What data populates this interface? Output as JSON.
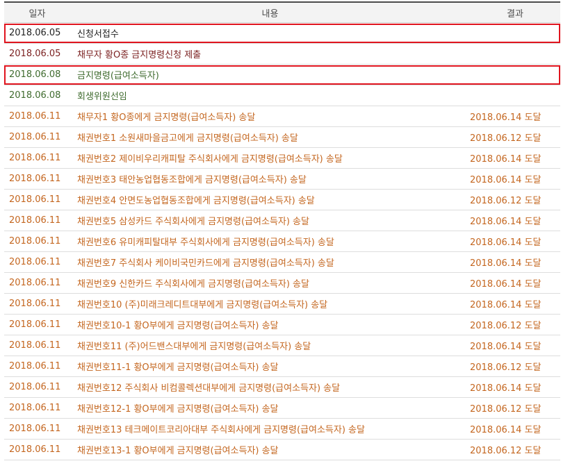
{
  "table": {
    "headers": {
      "date": "일자",
      "content": "내용",
      "result": "결과"
    },
    "rows": [
      {
        "date": "2018.06.05",
        "content": "신청서접수",
        "result": "",
        "tone": "black",
        "highlighted": true
      },
      {
        "date": "2018.06.05",
        "content": "채무자 황O종 금지명령신청 제출",
        "result": "",
        "tone": "darkred",
        "highlighted": false
      },
      {
        "date": "2018.06.08",
        "content": "금지명령(급여소득자)",
        "result": "",
        "tone": "green",
        "highlighted": true
      },
      {
        "date": "2018.06.08",
        "content": "회생위원선임",
        "result": "",
        "tone": "green",
        "highlighted": false
      },
      {
        "date": "2018.06.11",
        "content": "채무자1 황O종에게 금지명령(급여소득자) 송달",
        "result": "2018.06.14 도달",
        "tone": "orange",
        "highlighted": false
      },
      {
        "date": "2018.06.11",
        "content": "채권번호1 소원새마을금고에게 금지명령(급여소득자) 송달",
        "result": "2018.06.12 도달",
        "tone": "orange",
        "highlighted": false
      },
      {
        "date": "2018.06.11",
        "content": "채권번호2 제이비우리캐피탈 주식회사에게 금지명령(급여소득자) 송달",
        "result": "2018.06.14 도달",
        "tone": "orange",
        "highlighted": false
      },
      {
        "date": "2018.06.11",
        "content": "채권번호3 태안농업협동조합에게 금지명령(급여소득자) 송달",
        "result": "2018.06.14 도달",
        "tone": "orange",
        "highlighted": false
      },
      {
        "date": "2018.06.11",
        "content": "채권번호4 안면도농업협동조합에게 금지명령(급여소득자) 송달",
        "result": "2018.06.12 도달",
        "tone": "orange",
        "highlighted": false
      },
      {
        "date": "2018.06.11",
        "content": "채권번호5 삼성카드 주식회사에게 금지명령(급여소득자) 송달",
        "result": "2018.06.14 도달",
        "tone": "orange",
        "highlighted": false
      },
      {
        "date": "2018.06.11",
        "content": "채권번호6 유미캐피탈대부 주식회사에게 금지명령(급여소득자) 송달",
        "result": "2018.06.14 도달",
        "tone": "orange",
        "highlighted": false
      },
      {
        "date": "2018.06.11",
        "content": "채권번호7 주식회사 케이비국민카드에게 금지명령(급여소득자) 송달",
        "result": "2018.06.14 도달",
        "tone": "orange",
        "highlighted": false
      },
      {
        "date": "2018.06.11",
        "content": "채권번호9 신한카드 주식회사에게 금지명령(급여소득자) 송달",
        "result": "2018.06.14 도달",
        "tone": "orange",
        "highlighted": false
      },
      {
        "date": "2018.06.11",
        "content": "채권번호10 (주)미래크레디트대부에게 금지명령(급여소득자) 송달",
        "result": "2018.06.14 도달",
        "tone": "orange",
        "highlighted": false
      },
      {
        "date": "2018.06.11",
        "content": "채권번호10-1 황O부에게 금지명령(급여소득자) 송달",
        "result": "2018.06.12 도달",
        "tone": "orange",
        "highlighted": false
      },
      {
        "date": "2018.06.11",
        "content": "채권번호11 (주)어드밴스대부에게 금지명령(급여소득자) 송달",
        "result": "2018.06.14 도달",
        "tone": "orange",
        "highlighted": false
      },
      {
        "date": "2018.06.11",
        "content": "채권번호11-1 황O부에게 금지명령(급여소득자) 송달",
        "result": "2018.06.12 도달",
        "tone": "orange",
        "highlighted": false
      },
      {
        "date": "2018.06.11",
        "content": "채권번호12 주식회사 비컴콜렉션대부에게 금지명령(급여소득자) 송달",
        "result": "2018.06.14 도달",
        "tone": "orange",
        "highlighted": false
      },
      {
        "date": "2018.06.11",
        "content": "채권번호12-1 황O부에게 금지명령(급여소득자) 송달",
        "result": "2018.06.12 도달",
        "tone": "orange",
        "highlighted": false
      },
      {
        "date": "2018.06.11",
        "content": "채권번호13 테크메이트코리아대부 주식회사에게 금지명령(급여소득자) 송달",
        "result": "2018.06.14 도달",
        "tone": "orange",
        "highlighted": false
      },
      {
        "date": "2018.06.11",
        "content": "채권번호13-1 황O부에게 금지명령(급여소득자) 송달",
        "result": "2018.06.12 도달",
        "tone": "orange",
        "highlighted": false
      }
    ]
  },
  "colors": {
    "black": "#222222",
    "darkred": "#7a1f1f",
    "green": "#3f6b2e",
    "orange": "#c4661f",
    "highlight": "#e0141e"
  }
}
